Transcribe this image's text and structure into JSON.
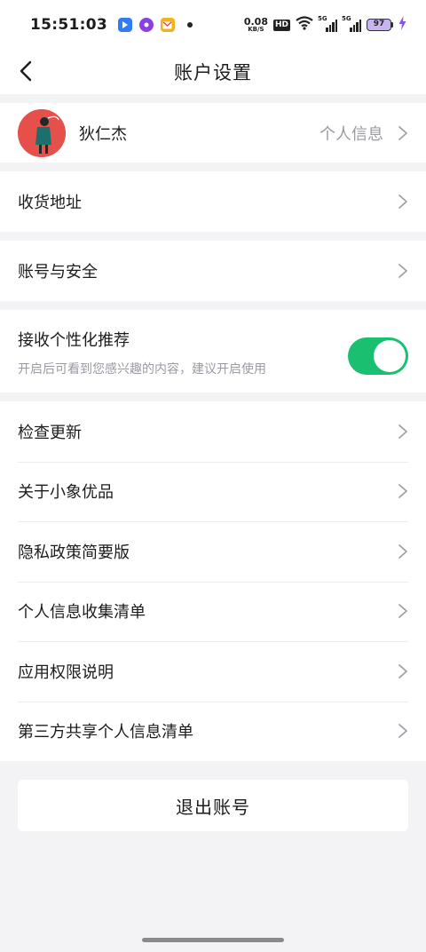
{
  "status_bar": {
    "time": "15:51:03",
    "net_speed_value": "0.08",
    "net_speed_unit": "KB/S",
    "hd_label": "HD",
    "sim1_tag": "5G",
    "sim2_tag": "5G",
    "battery_level": "97"
  },
  "header": {
    "title": "账户设置"
  },
  "profile": {
    "name": "狄仁杰",
    "link_label": "个人信息"
  },
  "rows": {
    "address": "收货地址",
    "account_security": "账号与安全"
  },
  "personalized": {
    "title": "接收个性化推荐",
    "description": "开启后可看到您感兴趣的内容，建议开启使用",
    "enabled": true
  },
  "info_list": [
    {
      "label": "检查更新"
    },
    {
      "label": "关于小象优品"
    },
    {
      "label": "隐私政策简要版"
    },
    {
      "label": "个人信息收集清单"
    },
    {
      "label": "应用权限说明"
    },
    {
      "label": "第三方共享个人信息清单"
    }
  ],
  "logout_label": "退出账号",
  "colors": {
    "accent_toggle": "#18c070",
    "avatar_bg": "#e5504a",
    "background": "#f3f3f6"
  }
}
